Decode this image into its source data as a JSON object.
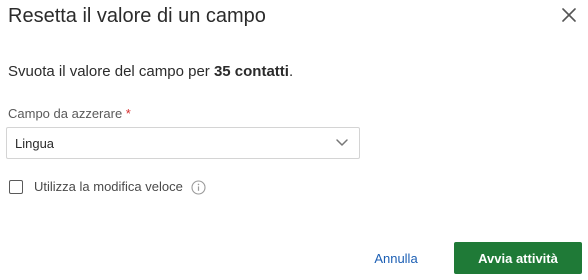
{
  "dialog": {
    "title": "Resetta il valore di un campo",
    "close_icon": "close-icon",
    "description": {
      "prefix": "Svuota il valore del campo per ",
      "count": "35 contatti",
      "suffix": "."
    },
    "field": {
      "label": "Campo da azzerare",
      "required_marker": "*",
      "selected_value": "Lingua",
      "chevron_icon": "chevron-down-icon"
    },
    "quick_edit": {
      "label": "Utilizza la modifica veloce",
      "checked": false,
      "info_icon": "info-icon"
    },
    "actions": {
      "cancel_label": "Annulla",
      "confirm_label": "Avvia attività"
    }
  },
  "colors": {
    "primary_button": "#1f7a37",
    "link": "#1c5fb4",
    "required": "#d62d2d"
  }
}
